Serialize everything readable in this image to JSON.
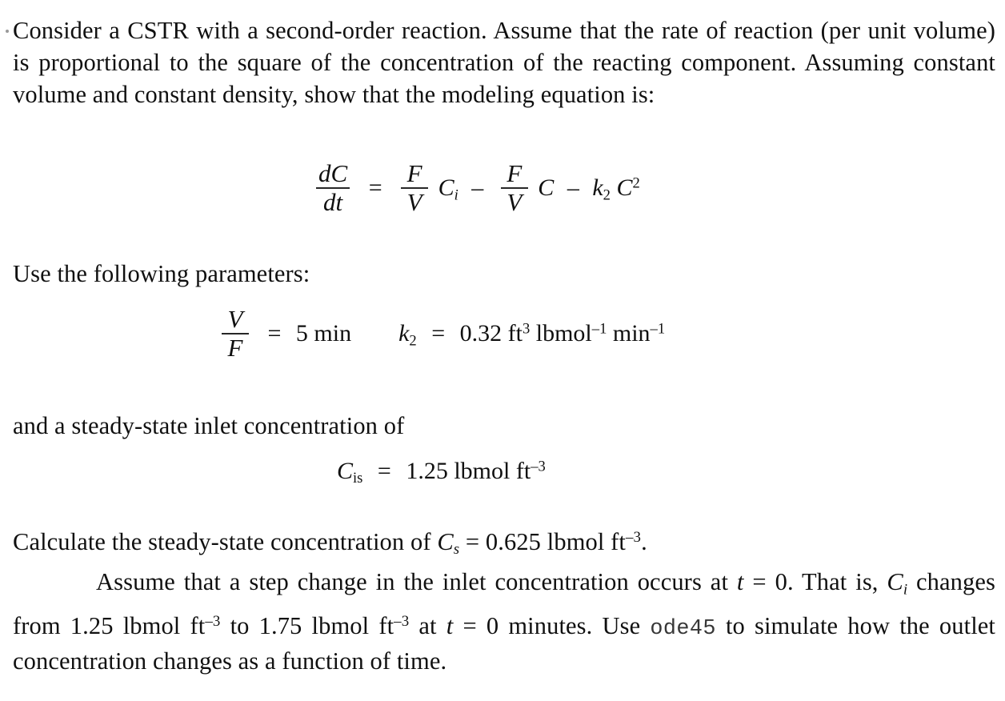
{
  "document": {
    "type": "textbook-problem-scan",
    "background_color": "#ffffff",
    "text_color": "#141414"
  },
  "paragraphs": {
    "intro": "Consider a CSTR with a second-order reaction. Assume that the rate of reaction (per unit volume) is proportional to the square of the concentration of the reacting component. Assuming constant volume and constant density, show that the modeling equation is:",
    "use_parameters": "Use the following parameters:",
    "inlet": "and a steady-state inlet concentration of",
    "calculate_lead": "Calculate the steady-state concentration of ",
    "calculate_tail": ".",
    "assume_lead": "Assume that a step change in the inlet concentration occurs at ",
    "assume_mid": ". That is, ",
    "changes_lead": " changes from 1.25 lbmol ft",
    "changes_mid": " to 1.75 lbmol ft",
    "changes_at": " at ",
    "changes_tail": " minutes. Use ",
    "ode_name": "ode45",
    "closing": " to simulate how the outlet concentration changes as a function of time."
  },
  "equations": {
    "model": {
      "label": "modeling-equation",
      "latex": "dC/dt = (F/V) C_i - (F/V) C - k_2 C^2",
      "lhs_num": "dC",
      "lhs_den": "dt",
      "equals": "=",
      "term1_num": "F",
      "term1_den": "V",
      "term1_var": "C",
      "term1_sub": "i",
      "minus1": "–",
      "term2_num": "F",
      "term2_den": "V",
      "term2_var": "C",
      "minus2": "–",
      "term3_k": "k",
      "term3_k_sub": "2",
      "term3_var": "C",
      "term3_sup": "2"
    },
    "parameters": {
      "label": "parameter-values",
      "vf_num": "V",
      "vf_den": "F",
      "vf_equals": "=",
      "vf_value": "5 min",
      "k2_symbol": "k",
      "k2_sub": "2",
      "k2_equals": "=",
      "k2_value": "0.32",
      "k2_unit_ft": "ft",
      "k2_unit_ft_exp": "3",
      "k2_unit_lbmol": "lbmol",
      "k2_unit_lbmol_exp": "–1",
      "k2_unit_min": "min",
      "k2_unit_min_exp": "–1"
    },
    "inlet_concentration": {
      "label": "inlet-concentration-equation",
      "symbol": "C",
      "subscript": "is",
      "equals": "=",
      "value": "1.25",
      "unit": "lbmol ft",
      "unit_exp": "–3"
    }
  },
  "values": {
    "tau_vf": "5 min",
    "k2": "0.32 ft³ lbmol⁻¹ min⁻¹",
    "c_is": "1.25 lbmol ft⁻³",
    "c_s": "0.625 lbmol ft⁻³",
    "c_i_initial": "1.25 lbmol ft⁻³",
    "c_i_final": "1.75 lbmol ft⁻³",
    "step_time": "0",
    "solver": "ode45"
  },
  "symbols": {
    "C": "C",
    "C_s_sub": "s",
    "C_i_sub": "i",
    "t": "t",
    "equals": "=",
    "cs_value": "0.625",
    "cs_unit": "lbmol ft",
    "cs_unit_exp": "–3",
    "t_equals_zero": "0",
    "ft_exp_neg3": "–3"
  }
}
